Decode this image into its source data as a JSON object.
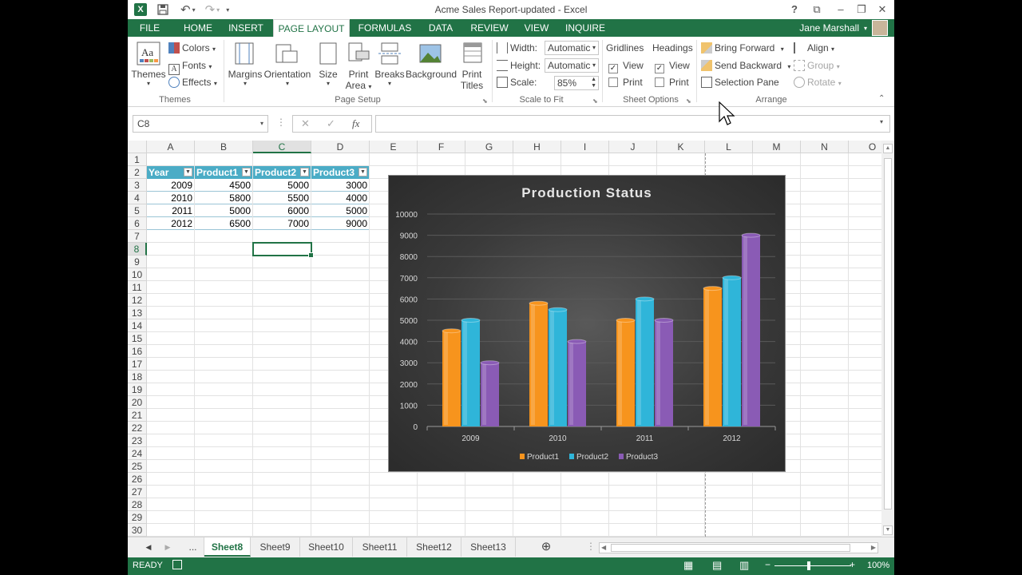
{
  "window": {
    "title": "Acme Sales Report-updated - Excel"
  },
  "tabs": [
    "FILE",
    "HOME",
    "INSERT",
    "PAGE LAYOUT",
    "FORMULAS",
    "DATA",
    "REVIEW",
    "VIEW",
    "INQUIRE"
  ],
  "user": {
    "name": "Jane Marshall"
  },
  "ribbon": {
    "themes": {
      "themes": "Themes",
      "colors": "Colors",
      "fonts": "Fonts",
      "effects": "Effects",
      "group": "Themes"
    },
    "page_setup": {
      "margins": "Margins",
      "orientation": "Orientation",
      "size": "Size",
      "print_area_1": "Print",
      "print_area_2": "Area",
      "breaks": "Breaks",
      "background": "Background",
      "print_titles_1": "Print",
      "print_titles_2": "Titles",
      "group": "Page Setup"
    },
    "scale": {
      "width_label": "Width:",
      "width_value": "Automatic",
      "height_label": "Height:",
      "height_value": "Automatic",
      "scale_label": "Scale:",
      "scale_value": "85%",
      "group": "Scale to Fit"
    },
    "sheet_options": {
      "gridlines": "Gridlines",
      "headings": "Headings",
      "view": "View",
      "print": "Print",
      "group": "Sheet Options"
    },
    "arrange": {
      "bring_forward": "Bring Forward",
      "send_backward": "Send Backward",
      "selection_pane": "Selection Pane",
      "align": "Align",
      "group_btn": "Group",
      "rotate": "Rotate",
      "group": "Arrange"
    }
  },
  "formula_bar": {
    "name_box": "C8",
    "formula": ""
  },
  "columns": [
    "A",
    "B",
    "C",
    "D",
    "E",
    "F",
    "G",
    "H",
    "I",
    "J",
    "K",
    "L",
    "M",
    "N",
    "O"
  ],
  "rows": [
    "1",
    "2",
    "3",
    "4",
    "5",
    "6",
    "7",
    "8",
    "9",
    "10",
    "11",
    "12",
    "13",
    "14",
    "15",
    "16",
    "17",
    "18",
    "19",
    "20",
    "21",
    "22",
    "23",
    "24",
    "25",
    "26",
    "27",
    "28",
    "29",
    "30"
  ],
  "table": {
    "headers": [
      "Year",
      "Product1",
      "Product2",
      "Product3"
    ],
    "rows": [
      [
        "2009",
        "4500",
        "5000",
        "3000"
      ],
      [
        "2010",
        "5800",
        "5500",
        "4000"
      ],
      [
        "2011",
        "5000",
        "6000",
        "5000"
      ],
      [
        "2012",
        "6500",
        "7000",
        "9000"
      ]
    ]
  },
  "chart_data": {
    "type": "bar",
    "title": "Production Status",
    "categories": [
      "2009",
      "2010",
      "2011",
      "2012"
    ],
    "series": [
      {
        "name": "Product1",
        "values": [
          4500,
          5800,
          5000,
          6500
        ],
        "color": "#f7941d"
      },
      {
        "name": "Product2",
        "values": [
          5000,
          5500,
          6000,
          7000
        ],
        "color": "#2fb5d9"
      },
      {
        "name": "Product3",
        "values": [
          3000,
          4000,
          5000,
          9000
        ],
        "color": "#8a5bb5"
      }
    ],
    "ylim": [
      0,
      10000
    ],
    "yticks": [
      0,
      1000,
      2000,
      3000,
      4000,
      5000,
      6000,
      7000,
      8000,
      9000,
      10000
    ],
    "xlabel": "",
    "ylabel": "",
    "grid": true,
    "legend": "bottom"
  },
  "sheets": [
    "...",
    "Sheet8",
    "Sheet9",
    "Sheet10",
    "Sheet11",
    "Sheet12",
    "Sheet13"
  ],
  "active_sheet": "Sheet8",
  "status": {
    "mode": "READY",
    "zoom": "100%"
  },
  "colors": {
    "excel_green": "#217346",
    "table_header": "#4bacc6"
  }
}
